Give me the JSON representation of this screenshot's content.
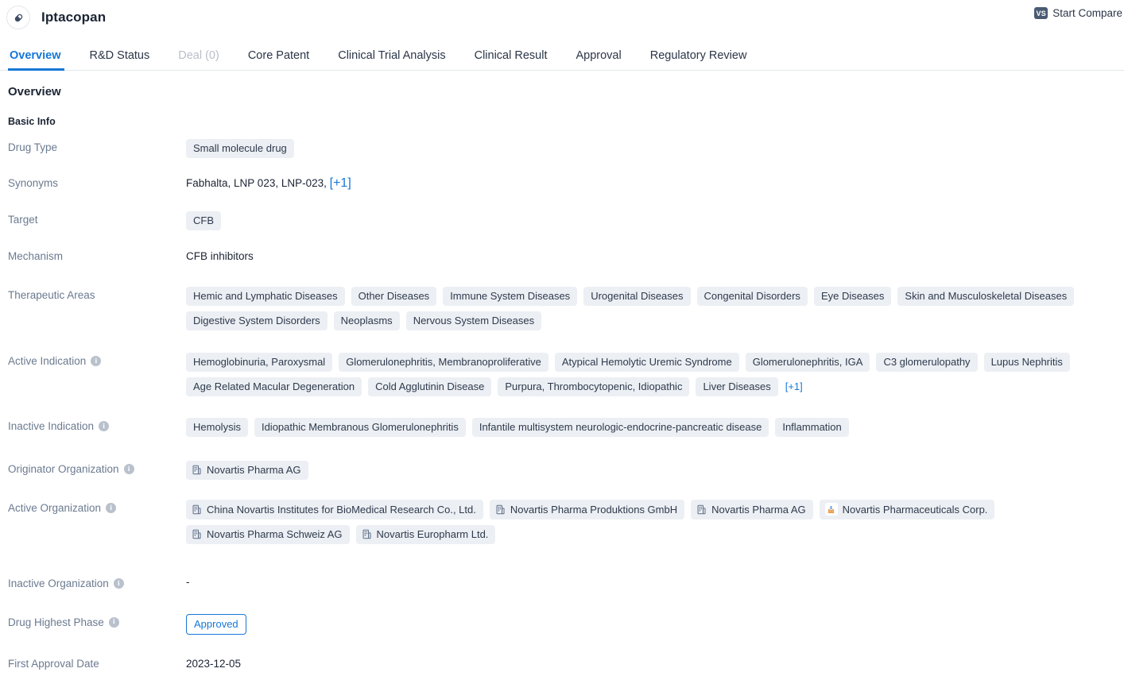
{
  "header": {
    "drug_name": "Iptacopan",
    "pill_icon": "pill-icon",
    "compare_label": "Start Compare",
    "vs_badge": "VS"
  },
  "tabs": [
    {
      "label": "Overview",
      "state": "active"
    },
    {
      "label": "R&D Status",
      "state": "normal"
    },
    {
      "label": "Deal (0)",
      "state": "disabled"
    },
    {
      "label": "Core Patent",
      "state": "normal"
    },
    {
      "label": "Clinical Trial Analysis",
      "state": "normal"
    },
    {
      "label": "Clinical Result",
      "state": "normal"
    },
    {
      "label": "Approval",
      "state": "normal"
    },
    {
      "label": "Regulatory Review",
      "state": "normal"
    }
  ],
  "page": {
    "section_title": "Overview",
    "sub_title": "Basic Info"
  },
  "fields": {
    "drug_type": {
      "label": "Drug Type",
      "tags": [
        "Small molecule drug"
      ]
    },
    "synonyms": {
      "label": "Synonyms",
      "text": "Fabhalta,  LNP 023,  LNP-023, ",
      "more": "[+1]"
    },
    "target": {
      "label": "Target",
      "tags": [
        "CFB"
      ]
    },
    "mechanism": {
      "label": "Mechanism",
      "text": "CFB inhibitors"
    },
    "therapeutic_areas": {
      "label": "Therapeutic Areas",
      "tags": [
        "Hemic and Lymphatic Diseases",
        "Other Diseases",
        "Immune System Diseases",
        "Urogenital Diseases",
        "Congenital Disorders",
        "Eye Diseases",
        "Skin and Musculoskeletal Diseases",
        "Digestive System Disorders",
        "Neoplasms",
        "Nervous System Diseases"
      ]
    },
    "active_indication": {
      "label": "Active Indication",
      "has_info": true,
      "tags": [
        "Hemoglobinuria, Paroxysmal",
        "Glomerulonephritis, Membranoproliferative",
        "Atypical Hemolytic Uremic Syndrome",
        "Glomerulonephritis, IGA",
        "C3 glomerulopathy",
        "Lupus Nephritis",
        "Age Related Macular Degeneration",
        "Cold Agglutinin Disease",
        "Purpura, Thrombocytopenic, Idiopathic",
        "Liver Diseases"
      ],
      "more": "[+1]"
    },
    "inactive_indication": {
      "label": "Inactive Indication",
      "has_info": true,
      "tags": [
        "Hemolysis",
        "Idiopathic Membranous Glomerulonephritis",
        "Infantile multisystem neurologic-endocrine-pancreatic disease",
        "Inflammation"
      ]
    },
    "originator_organization": {
      "label": "Originator Organization",
      "has_info": true,
      "orgs": [
        {
          "name": "Novartis Pharma AG",
          "icon": "building-icon"
        }
      ]
    },
    "active_organization": {
      "label": "Active Organization",
      "has_info": true,
      "orgs": [
        {
          "name": "China Novartis Institutes for BioMedical Research Co., Ltd.",
          "icon": "building-icon"
        },
        {
          "name": "Novartis Pharma Produktions GmbH",
          "icon": "building-icon"
        },
        {
          "name": "Novartis Pharma AG",
          "icon": "building-icon"
        },
        {
          "name": "Novartis Pharmaceuticals Corp.",
          "icon": "company-logo-icon"
        },
        {
          "name": "Novartis Pharma Schweiz AG",
          "icon": "building-icon"
        },
        {
          "name": "Novartis Europharm Ltd.",
          "icon": "building-icon"
        }
      ]
    },
    "inactive_organization": {
      "label": "Inactive Organization",
      "has_info": true,
      "value": "-"
    },
    "drug_highest_phase": {
      "label": "Drug Highest Phase",
      "has_info": true,
      "badge": "Approved"
    },
    "first_approval_date": {
      "label": "First Approval Date",
      "value": "2023-12-05"
    }
  },
  "colors": {
    "accent": "#1677d8",
    "tag_bg": "#eceff3",
    "label": "#6b7a90",
    "text": "#1b2434",
    "vs_badge_bg": "#4a5a73"
  }
}
